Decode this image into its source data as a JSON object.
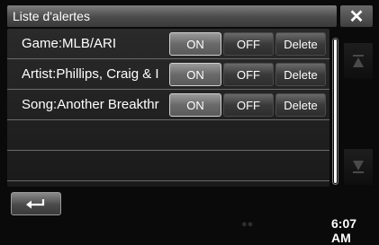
{
  "window": {
    "title": "Liste d'alertes",
    "close_icon": "close-icon"
  },
  "alerts": [
    {
      "label": "Game:MLB/ARI",
      "on_label": "ON",
      "off_label": "OFF",
      "delete_label": "Delete",
      "state": "on"
    },
    {
      "label": "Artist:Phillips, Craig & I",
      "on_label": "ON",
      "off_label": "OFF",
      "delete_label": "Delete",
      "state": "on"
    },
    {
      "label": "Song:Another Breakthr",
      "on_label": "ON",
      "off_label": "OFF",
      "delete_label": "Delete",
      "state": "on"
    }
  ],
  "scroll": {
    "up_icon": "arrow-up-bar-icon",
    "down_icon": "arrow-down-bar-icon"
  },
  "footer": {
    "back_icon": "return-arrow-icon",
    "clock": "6:07 AM"
  },
  "colors": {
    "background": "#0a0a0a",
    "active_button": "#8a8a8a",
    "inactive_button": "#3a3a3a"
  }
}
